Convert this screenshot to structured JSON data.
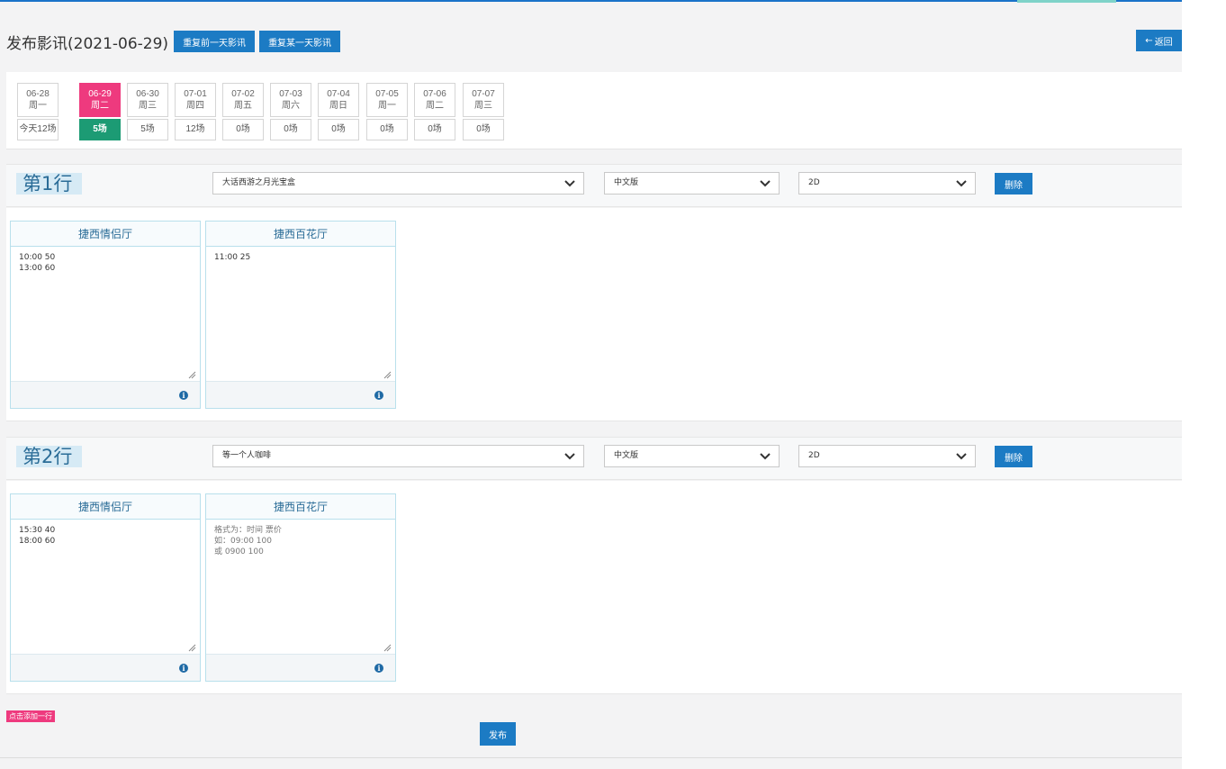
{
  "header": {
    "title": "发布影讯(2021-06-29)",
    "repeat_prev_label": "重复前一天影讯",
    "repeat_some_label": "重复某一天影讯",
    "back_label": "返回"
  },
  "dates": [
    {
      "date": "06-28",
      "weekday": "周一",
      "count": "今天12场",
      "active": false
    },
    {
      "date": "06-29",
      "weekday": "周二",
      "count": "5场",
      "active": true
    },
    {
      "date": "06-30",
      "weekday": "周三",
      "count": "5场",
      "active": false
    },
    {
      "date": "07-01",
      "weekday": "周四",
      "count": "12场",
      "active": false
    },
    {
      "date": "07-02",
      "weekday": "周五",
      "count": "0场",
      "active": false
    },
    {
      "date": "07-03",
      "weekday": "周六",
      "count": "0场",
      "active": false
    },
    {
      "date": "07-04",
      "weekday": "周日",
      "count": "0场",
      "active": false
    },
    {
      "date": "07-05",
      "weekday": "周一",
      "count": "0场",
      "active": false
    },
    {
      "date": "07-06",
      "weekday": "周二",
      "count": "0场",
      "active": false
    },
    {
      "date": "07-07",
      "weekday": "周三",
      "count": "0场",
      "active": false
    }
  ],
  "rows": [
    {
      "label": "第1行",
      "movie": "大话西游之月光宝盒",
      "language": "中文版",
      "format": "2D",
      "delete_label": "删除",
      "halls": [
        {
          "name": "捷西情侣厅",
          "value": "10:00 50\n13:00 60",
          "placeholder": ""
        },
        {
          "name": "捷西百花厅",
          "value": "11:00 25",
          "placeholder": ""
        }
      ]
    },
    {
      "label": "第2行",
      "movie": "等一个人咖啡",
      "language": "中文版",
      "format": "2D",
      "delete_label": "删除",
      "halls": [
        {
          "name": "捷西情侣厅",
          "value": "15:30 40\n18:00 60",
          "placeholder": ""
        },
        {
          "name": "捷西百花厅",
          "value": "",
          "placeholder": "格式为：时间 票价\n                         如：09:00 100\n                         或 0900 100"
        }
      ]
    }
  ],
  "footer": {
    "add_row_label": "点击添加一行",
    "publish_label": "发布"
  },
  "colors": {
    "primary": "#1c7bc4",
    "active_date": "#ee3a7e",
    "active_count": "#1c9b74",
    "row_label_bg": "#d6eaf5"
  }
}
